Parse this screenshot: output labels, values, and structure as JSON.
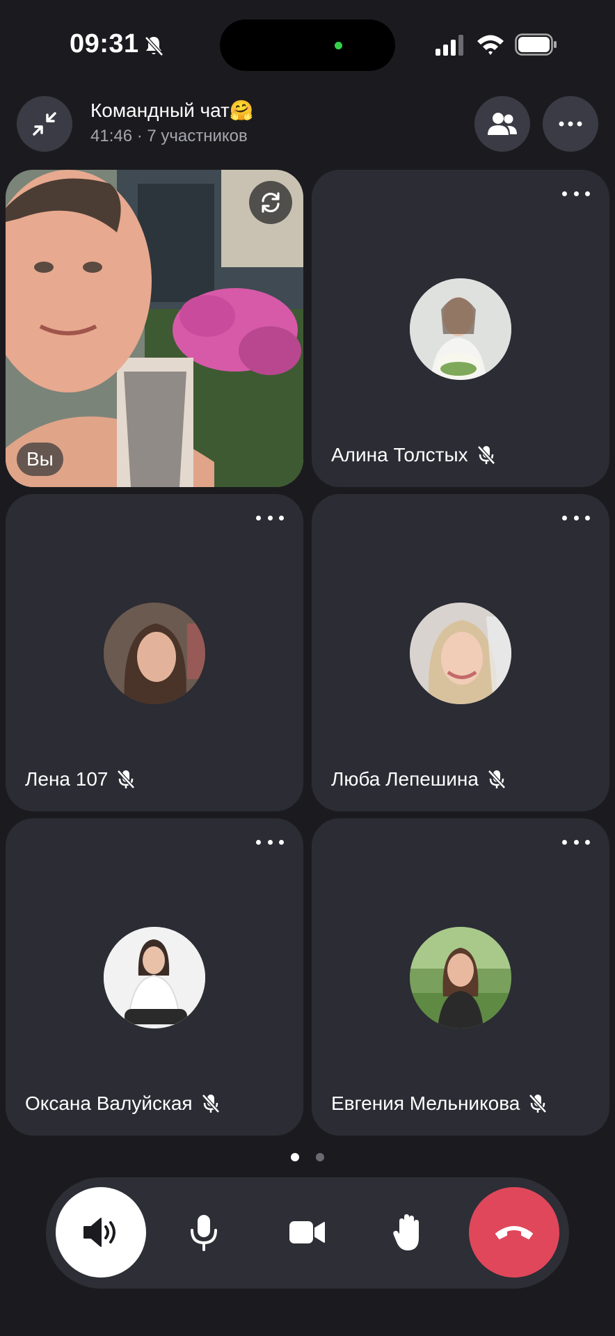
{
  "status_bar": {
    "time": "09:31"
  },
  "header": {
    "title": "Командный чат🤗",
    "subtitle": "41:46 · 7 участников"
  },
  "self_tile": {
    "label": "Вы"
  },
  "participants": [
    {
      "name": "Алина Толстых",
      "muted": true,
      "avatar_color": "#d8dad8"
    },
    {
      "name": "Лена 107",
      "muted": true,
      "avatar_color": "#5b463c"
    },
    {
      "name": "Люба Лепешина",
      "muted": true,
      "avatar_color": "#cfc6c2"
    },
    {
      "name": "Оксана Валуйская",
      "muted": true,
      "avatar_color": "#f1f1f1"
    },
    {
      "name": "Евгения Мельникова",
      "muted": true,
      "avatar_color": "#6c8a52"
    }
  ],
  "pagination": {
    "pages": 2,
    "current": 1
  },
  "controls": {
    "speaker_icon": "speaker-icon",
    "mic_icon": "microphone-icon",
    "camera_icon": "video-camera-icon",
    "hand_icon": "raise-hand-icon",
    "end_icon": "end-call-icon"
  },
  "colors": {
    "background": "#1b1b1f",
    "tile": "#2b2c34",
    "end_call": "#e0475a",
    "secondary_text": "#a5a6ae"
  }
}
